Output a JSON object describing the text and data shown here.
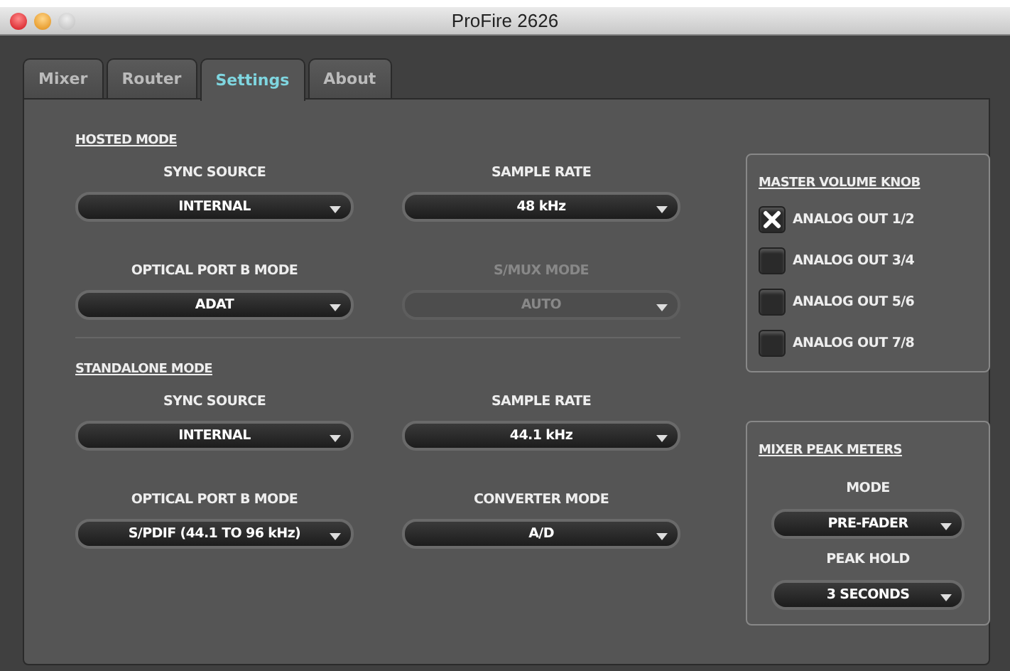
{
  "window": {
    "title": "ProFire 2626"
  },
  "tabs": [
    {
      "label": "Mixer",
      "selected": false
    },
    {
      "label": "Router",
      "selected": false
    },
    {
      "label": "Settings",
      "selected": true
    },
    {
      "label": "About",
      "selected": false
    }
  ],
  "sections": [
    {
      "title": "HOSTED MODE",
      "fields": [
        {
          "label": "SYNC SOURCE",
          "value": "INTERNAL",
          "disabled": false
        },
        {
          "label": "SAMPLE RATE",
          "value": "48 kHz",
          "disabled": false
        },
        {
          "label": "OPTICAL PORT B MODE",
          "value": "ADAT",
          "disabled": false
        },
        {
          "label": "S/MUX MODE",
          "value": "AUTO",
          "disabled": true
        }
      ]
    },
    {
      "title": "STANDALONE MODE",
      "fields": [
        {
          "label": "SYNC SOURCE",
          "value": "INTERNAL",
          "disabled": false
        },
        {
          "label": "SAMPLE RATE",
          "value": "44.1 kHz",
          "disabled": false
        },
        {
          "label": "OPTICAL PORT B MODE",
          "value": "S/PDIF (44.1 TO 96 kHz)",
          "disabled": false
        },
        {
          "label": "CONVERTER MODE",
          "value": "A/D",
          "disabled": false
        }
      ]
    }
  ],
  "master_volume_knob": {
    "title": "MASTER VOLUME KNOB",
    "outputs": [
      {
        "label": "ANALOG OUT 1/2",
        "checked": true
      },
      {
        "label": "ANALOG OUT 3/4",
        "checked": false
      },
      {
        "label": "ANALOG OUT 5/6",
        "checked": false
      },
      {
        "label": "ANALOG OUT 7/8",
        "checked": false
      }
    ]
  },
  "mixer_peak_meters": {
    "title": "MIXER PEAK METERS",
    "fields": [
      {
        "label": "MODE",
        "value": "PRE-FADER"
      },
      {
        "label": "PEAK HOLD",
        "value": "3 SECONDS"
      }
    ]
  }
}
